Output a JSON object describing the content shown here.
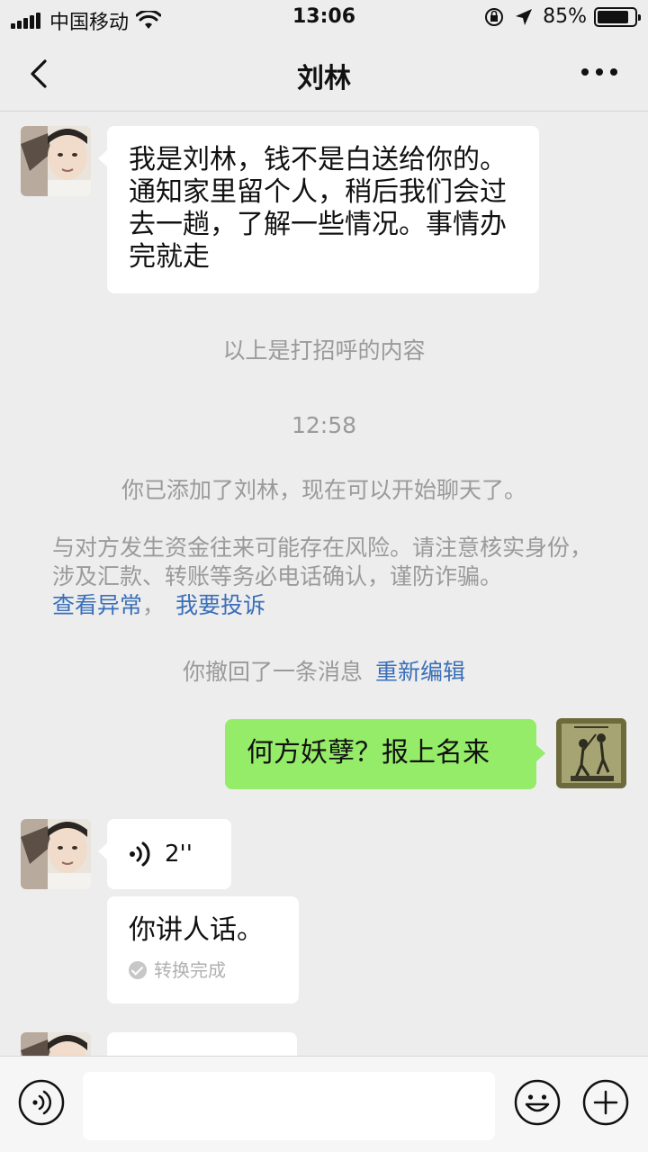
{
  "status_bar": {
    "carrier": "中国移动",
    "time": "13:06",
    "battery": "85%",
    "battery_level": 0.85
  },
  "nav": {
    "title": "刘林"
  },
  "messages": {
    "greeting_text": "我是刘林，钱不是白送给你的。通知家里留个人，稍后我们会过去一趟，了解一些情况。事情办完就走",
    "greeting_note": "以上是打招呼的内容",
    "timestamp": "12:58",
    "added_notice": "你已添加了刘林，现在可以开始聊天了。",
    "risk_notice": "与对方发生资金往来可能存在风险。请注意核实身份，涉及汇款、转账等务必电话确认，谨防诈骗。",
    "risk_link1": "查看异常",
    "risk_separator": "，",
    "risk_link2": "我要投诉",
    "recall_text": "你撤回了一条消息",
    "recall_edit": "重新编辑",
    "my_message": "何方妖孽？报上名来",
    "voice_duration": "2''",
    "voice_transcript": "你讲人话。",
    "convert_status": "转换完成"
  },
  "input_bar": {
    "placeholder": ""
  },
  "colors": {
    "background": "#ededed",
    "my_bubble": "#95ec69",
    "other_bubble": "#ffffff",
    "link": "#3a6fb8",
    "system_text": "#9a9a9a"
  }
}
